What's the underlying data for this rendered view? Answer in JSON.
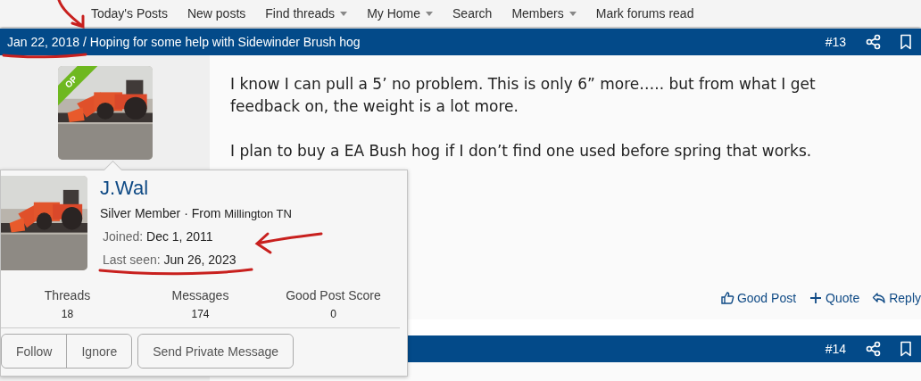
{
  "nav": [
    {
      "label": "Today's Posts",
      "dropdown": false
    },
    {
      "label": "New posts",
      "dropdown": false
    },
    {
      "label": "Find threads",
      "dropdown": true
    },
    {
      "label": "My Home",
      "dropdown": true
    },
    {
      "label": "Search",
      "dropdown": false
    },
    {
      "label": "Members",
      "dropdown": true
    },
    {
      "label": "Mark forums read",
      "dropdown": false
    }
  ],
  "posts": [
    {
      "date": "Jan 22, 2018",
      "separator": "/",
      "title": "Hoping for some help with Sidewinder Brush hog",
      "number": "#13",
      "badge": "OP",
      "avatar": {
        "kind": "picture"
      },
      "paragraphs": [
        "I know I can pull a 5’ no problem. This is only 6” more….. but from what I get feedback on, the weight is a lot more.",
        "I plan to buy a EA Bush hog if I don’t find one used before spring that works."
      ],
      "actions": [
        {
          "kind": "like",
          "label": "Good Post"
        },
        {
          "kind": "quote",
          "label": "Quote"
        },
        {
          "kind": "reply",
          "label": "Reply"
        }
      ]
    },
    {
      "number": "#14"
    }
  ],
  "member_card": {
    "avatar": {
      "kind": "picture"
    },
    "name": "J.Wal",
    "title": "Silver Member",
    "dot": "·",
    "from_label": "From",
    "location": "Millington TN",
    "facts": [
      {
        "label": "Joined:",
        "value": "Dec 1, 2011"
      },
      {
        "label": "Last seen:",
        "value": "Jun 26, 2023"
      }
    ],
    "stats": [
      {
        "label": "Threads",
        "value": "18"
      },
      {
        "label": "Messages",
        "value": "174"
      },
      {
        "label": "Good Post Score",
        "value": "0"
      }
    ],
    "button_groups": [
      [
        "Follow",
        "Ignore"
      ],
      [
        "Send Private Message"
      ]
    ]
  }
}
